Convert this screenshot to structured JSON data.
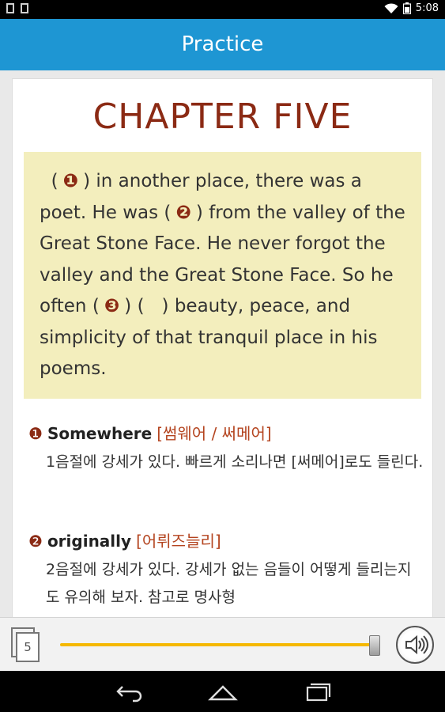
{
  "status_bar": {
    "time": "5:08"
  },
  "app_bar": {
    "title": "Practice"
  },
  "content": {
    "chapter_title": "CHAPTER FIVE",
    "passage": {
      "p1": "(",
      "n1": "❶",
      "p2": ") in another place, there was a poet. He was (",
      "n2": "❷",
      "p3": ") from the valley of the Great Stone Face. He never forgot the valley and the Great Stone Face. So he often (",
      "n3": "❸",
      "p4": ") (",
      "p5": ") beauty, peace, and simplicity of that tranquil place in his poems."
    },
    "vocab": [
      {
        "num": "❶",
        "word": "Somewhere",
        "pronunciation": "[썸웨어 / 써메어]",
        "explanation": "1음절에 강세가 있다. 빠르게 소리나면 [써메어]로도 들린다."
      },
      {
        "num": "❷",
        "word": "originally",
        "pronunciation": "[어뤼즈늘리]",
        "explanation": "2음절에 강세가 있다. 강세가 없는 음들이 어떻게 들리는지도 유의해 보자. 참고로 명사형"
      }
    ]
  },
  "player": {
    "page_number": "5",
    "progress": 0.99
  },
  "colors": {
    "accent": "#1e96d3",
    "chapter": "#8b2a14",
    "passage_bg": "#f3eebd",
    "slider": "#f5b800"
  }
}
